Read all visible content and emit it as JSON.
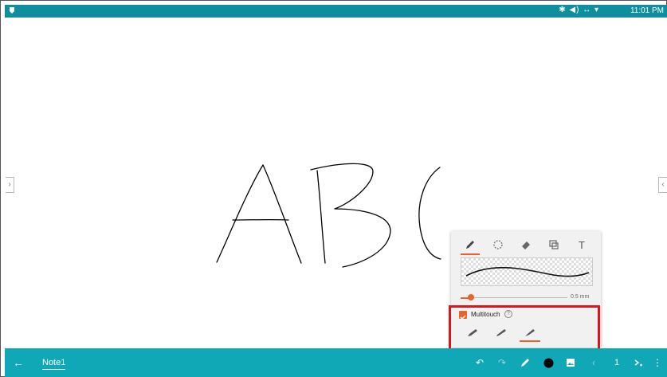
{
  "status_bar": {
    "time": "11:01 PM",
    "icons": [
      "bluetooth-icon",
      "volume-icon",
      "data-icon",
      "wifi-icon"
    ]
  },
  "canvas": {
    "handwriting": "ABC"
  },
  "pen_panel": {
    "tools": [
      "pen-icon",
      "lasso-icon",
      "eraser-icon",
      "shape-icon",
      "text-tool-icon"
    ],
    "text_tool_glyph": "T",
    "stroke_size": "0.5 mm",
    "stroke_size_value": 0.1,
    "multitouch_label": "Multitouch",
    "multitouch_checked": true,
    "help_glyph": "?",
    "pen_types": [
      "fountain-pen-icon",
      "ballpoint-pen-icon",
      "brush-pen-icon"
    ],
    "active_pen_type": 2
  },
  "bottom_bar": {
    "back_glyph": "←",
    "note_title": "Note1",
    "undo_glyph": "↶",
    "redo_glyph": "↷",
    "prev_glyph": "‹",
    "page_number": "1",
    "menu_glyph": "⋮"
  },
  "colors": {
    "status_bar": "#0f8f9e",
    "bottom_bar": "#10a7b7",
    "accent": "#e8622c",
    "highlight": "#e0131a",
    "ink": "#000000"
  }
}
